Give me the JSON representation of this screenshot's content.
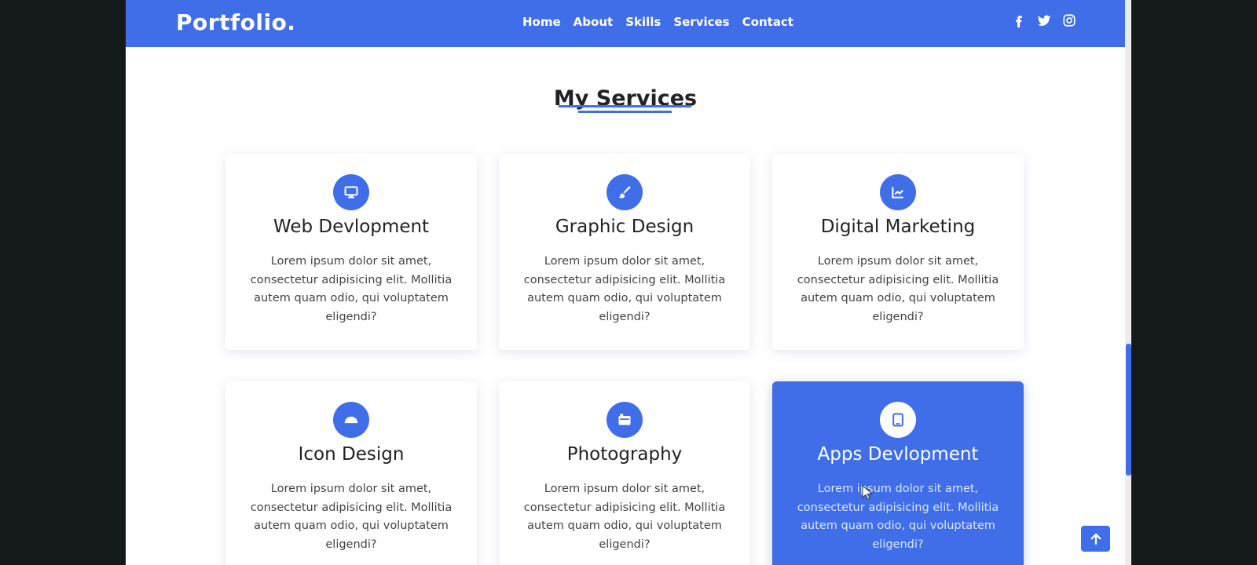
{
  "header": {
    "logo": "Portfolio.",
    "nav": [
      "Home",
      "About",
      "Skills",
      "Services",
      "Contact"
    ],
    "social_icons": [
      "facebook-icon",
      "twitter-icon",
      "instagram-icon"
    ]
  },
  "section": {
    "title": "My Services"
  },
  "services": [
    {
      "title": "Web Devlopment",
      "icon": "monitor-icon",
      "text": "Lorem ipsum dolor sit amet, consectetur adipisicing elit. Mollitia autem quam odio, qui voluptatem eligendi?"
    },
    {
      "title": "Graphic Design",
      "icon": "paintbrush-icon",
      "text": "Lorem ipsum dolor sit amet, consectetur adipisicing elit. Mollitia autem quam odio, qui voluptatem eligendi?"
    },
    {
      "title": "Digital Marketing",
      "icon": "chart-icon",
      "text": "Lorem ipsum dolor sit amet, consectetur adipisicing elit. Mollitia autem quam odio, qui voluptatem eligendi?"
    },
    {
      "title": "Icon Design",
      "icon": "half-circle-icon",
      "text": "Lorem ipsum dolor sit amet, consectetur adipisicing elit. Mollitia autem quam odio, qui voluptatem eligendi?"
    },
    {
      "title": "Photography",
      "icon": "camera-icon",
      "text": "Lorem ipsum dolor sit amet, consectetur adipisicing elit. Mollitia autem quam odio, qui voluptatem eligendi?"
    },
    {
      "title": "Apps Devlopment",
      "icon": "tablet-icon",
      "text": "Lorem ipsum dolor sit amet, consectetur adipisicing elit. Mollitia autem quam odio, qui voluptatem eligendi?",
      "active": true
    }
  ],
  "colors": {
    "accent": "#3f6ee8",
    "page_background": "#ffffff",
    "outer_background": "#141a19"
  },
  "scroll_to_top_icon": "arrow-up-icon"
}
